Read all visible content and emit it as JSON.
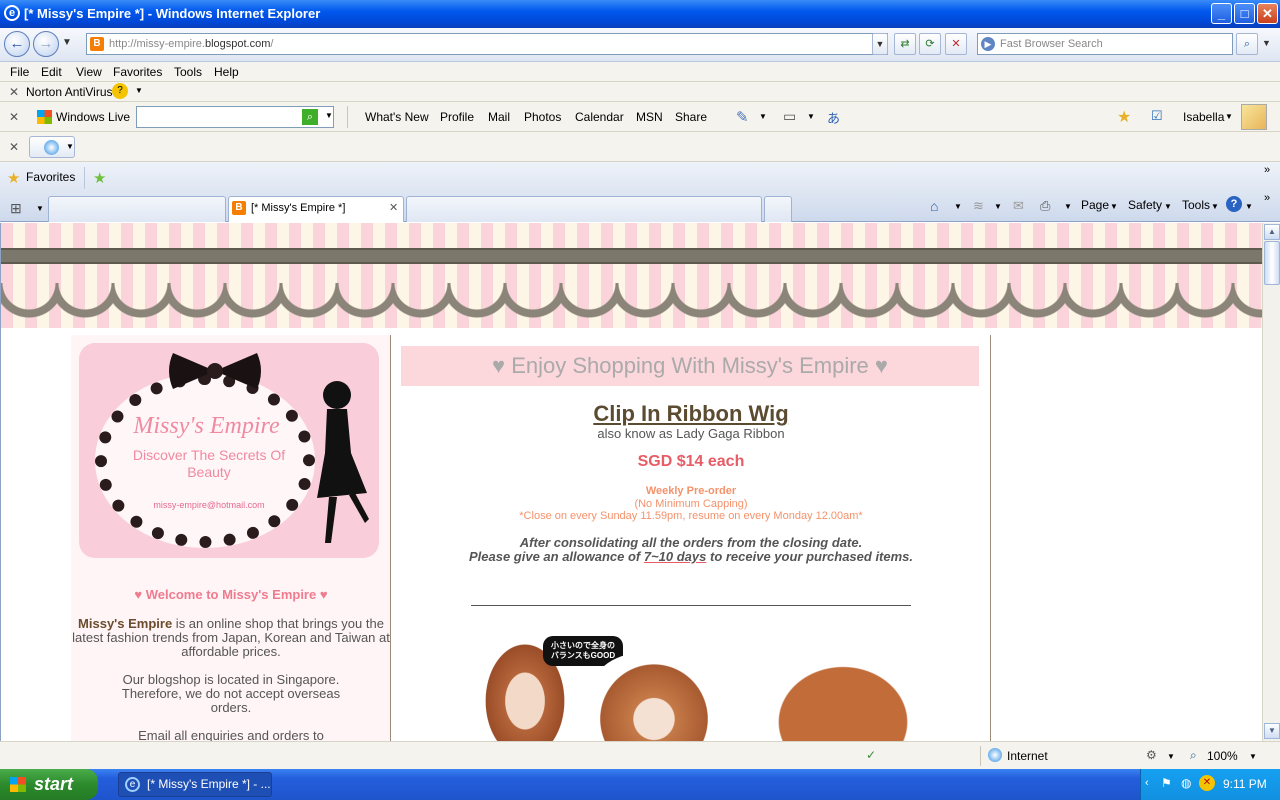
{
  "window": {
    "title": "[* Missy's Empire *] - Windows Internet Explorer",
    "minimize": "_",
    "maximize": "□",
    "close": "✕"
  },
  "address_bar": {
    "url_prefix": "http://missy-empire.",
    "url_domain": "blogspot.com",
    "url_suffix": "/",
    "search_placeholder": "Fast Browser Search"
  },
  "menu": [
    "File",
    "Edit",
    "View",
    "Favorites",
    "Tools",
    "Help"
  ],
  "norton": {
    "label": "Norton AntiVirus"
  },
  "live_toolbar": {
    "brand": "Windows Live",
    "links": [
      "What's New",
      "Profile",
      "Mail",
      "Photos",
      "Calendar",
      "MSN",
      "Share"
    ],
    "user": "Isabella"
  },
  "favorites": {
    "label": "Favorites"
  },
  "tabs": {
    "active": "[* Missy's Empire *]"
  },
  "command_bar": [
    "Page",
    "Safety",
    "Tools"
  ],
  "sidebar": {
    "logo_title": "Missy's Empire",
    "logo_sub": "Discover The Secrets Of Beauty",
    "logo_email": "missy-empire@hotmail.com",
    "welcome": "♥ Welcome to Missy's Empire ♥",
    "intro_brand": "Missy's Empire",
    "intro_text": " is an online shop that brings you the latest fashion trends from Japan, Korean and Taiwan at affordable prices.",
    "location": "Our blogshop is located in Singapore. Therefore, we do not accept overseas orders.",
    "email_line": "Email all enquiries and orders to"
  },
  "main": {
    "banner": "♥ Enjoy Shopping With Missy's Empire ♥",
    "product_title": "Clip In Ribbon Wig",
    "aka": "also know as Lady Gaga Ribbon",
    "price": "SGD $14 each",
    "preorder": "Weekly Pre-order",
    "no_cap": "(No Minimum Capping)",
    "closing": "*Close on every Sunday 11.59pm, resume on every Monday 12.00am*",
    "consolidate": "After consolidating all the orders from the closing date.",
    "allowance_pre": "Please give an allowance of ",
    "allowance_days": "7~10 days",
    "allowance_post": " to receive your purchased items.",
    "speech_bubble": "小さいので全身の バランスもGOOD"
  },
  "status_bar": {
    "zone": "Internet",
    "zoom": "100%"
  },
  "taskbar": {
    "start": "start",
    "item": "[* Missy's Empire *] - ...",
    "clock": "9:11 PM"
  }
}
